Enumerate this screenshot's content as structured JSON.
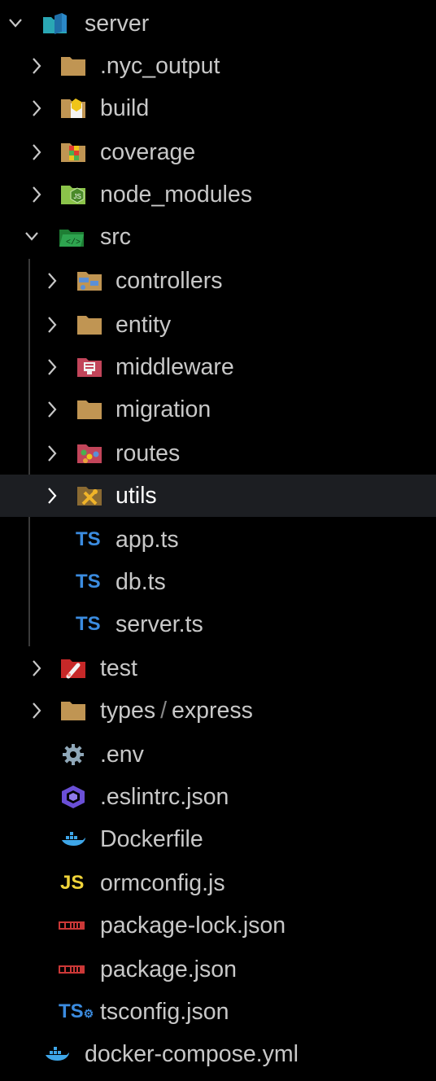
{
  "explorer": {
    "root": {
      "label": "server",
      "icon": "folder-server-open-icon"
    },
    "items": [
      {
        "label": ".nyc_output",
        "icon": "folder-icon"
      },
      {
        "label": "build",
        "icon": "folder-build-icon"
      },
      {
        "label": "coverage",
        "icon": "folder-coverage-icon"
      },
      {
        "label": "node_modules",
        "icon": "folder-node-icon"
      },
      {
        "label": "src",
        "icon": "folder-src-open-icon"
      },
      {
        "label": "controllers",
        "icon": "folder-controllers-icon"
      },
      {
        "label": "entity",
        "icon": "folder-icon"
      },
      {
        "label": "middleware",
        "icon": "folder-middleware-icon"
      },
      {
        "label": "migration",
        "icon": "folder-icon"
      },
      {
        "label": "routes",
        "icon": "folder-routes-icon"
      },
      {
        "label": "utils",
        "icon": "folder-utils-icon"
      },
      {
        "label": "app.ts",
        "icon": "typescript-icon",
        "badge": "TS"
      },
      {
        "label": "db.ts",
        "icon": "typescript-icon",
        "badge": "TS"
      },
      {
        "label": "server.ts",
        "icon": "typescript-icon",
        "badge": "TS"
      },
      {
        "label": "test",
        "icon": "folder-test-icon"
      },
      {
        "label_a": "types",
        "sep": "/",
        "label_b": "express",
        "icon": "folder-icon"
      },
      {
        "label": ".env",
        "icon": "gear-icon"
      },
      {
        "label": ".eslintrc.json",
        "icon": "eslint-icon"
      },
      {
        "label": "Dockerfile",
        "icon": "docker-icon"
      },
      {
        "label": "ormconfig.js",
        "icon": "javascript-icon",
        "badge": "JS"
      },
      {
        "label": "package-lock.json",
        "icon": "npm-icon"
      },
      {
        "label": "package.json",
        "icon": "npm-icon"
      },
      {
        "label": "tsconfig.json",
        "icon": "tsconfig-icon",
        "badge": "TS"
      },
      {
        "label": "docker-compose.yml",
        "icon": "docker-icon"
      }
    ]
  },
  "colors": {
    "background": "#000000",
    "selected_row": "#1c1e22",
    "folder": "#c09553",
    "typescript": "#3b8ce0",
    "javascript": "#f0d43a",
    "npm": "#cb3837"
  }
}
